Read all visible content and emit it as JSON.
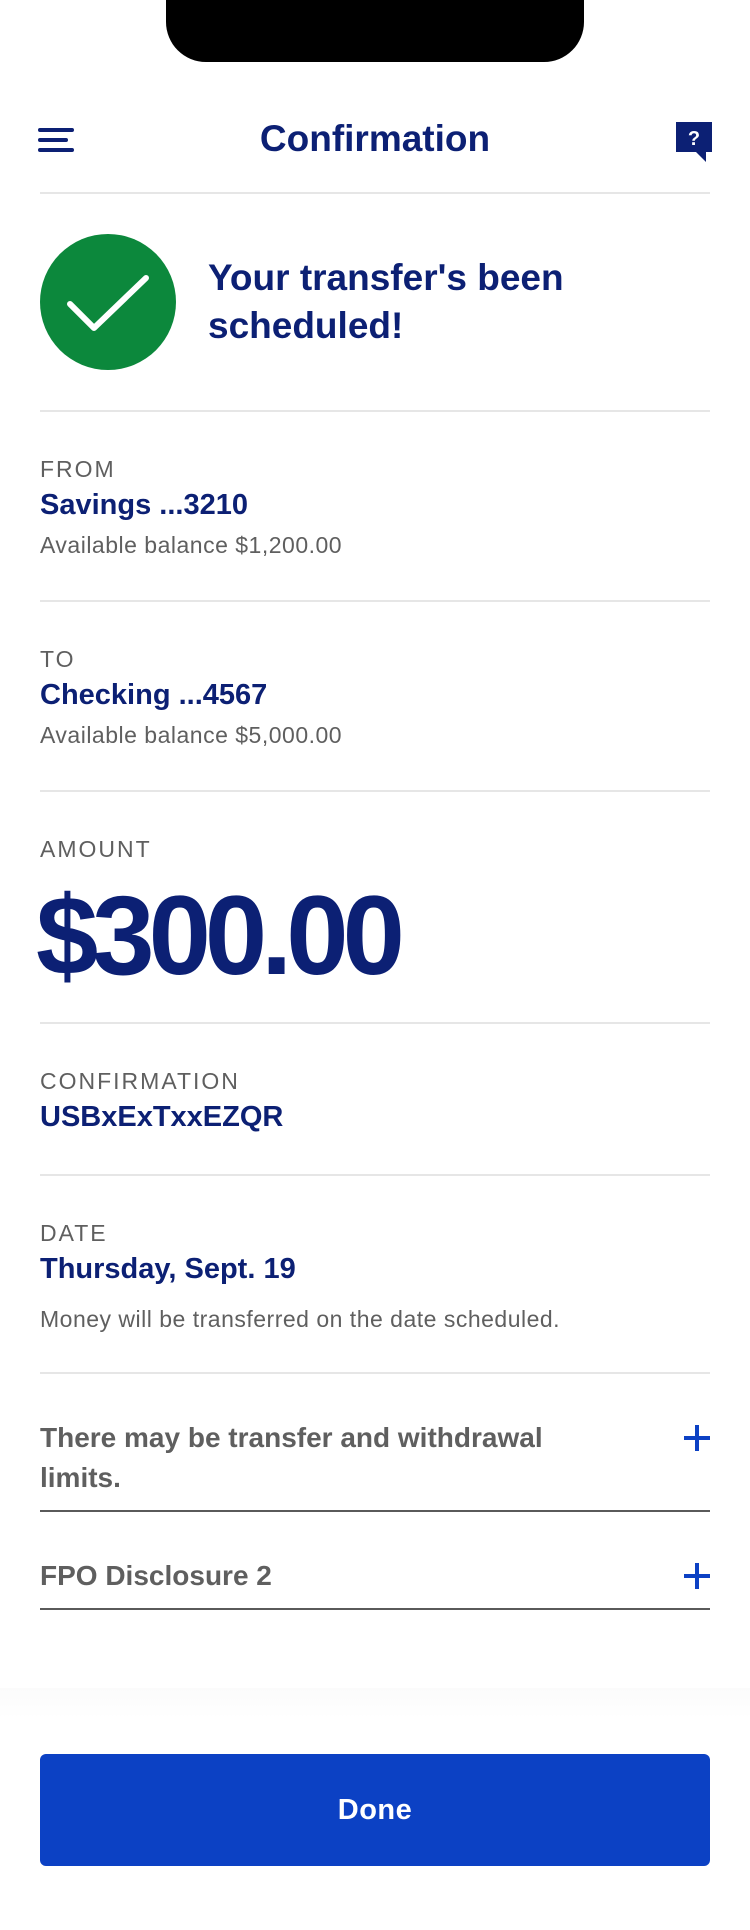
{
  "header": {
    "title": "Confirmation",
    "menu_icon": "hamburger-menu-icon",
    "help_icon": "help-chat-icon",
    "help_glyph": "?"
  },
  "success": {
    "message": "Your transfer's been scheduled!",
    "icon": "checkmark-icon",
    "color": "#0c883c"
  },
  "from": {
    "label": "FROM",
    "account": "Savings ...3210",
    "balance": "Available balance $1,200.00"
  },
  "to": {
    "label": "TO",
    "account": "Checking ...4567",
    "balance": "Available balance $5,000.00"
  },
  "amount": {
    "label": "AMOUNT",
    "value": "$300.00"
  },
  "confirmation": {
    "label": "CONFIRMATION",
    "code": "USBxExTxxEZQR"
  },
  "date": {
    "label": "DATE",
    "value": "Thursday, Sept. 19",
    "note": "Money will be transferred on the date scheduled."
  },
  "disclosures": [
    {
      "text": "There may be transfer and withdrawal limits."
    },
    {
      "text": "FPO Disclosure 2"
    }
  ],
  "footer": {
    "done_label": "Done"
  },
  "colors": {
    "primary_text": "#0c2074",
    "accent": "#0c41c4",
    "secondary_text": "#5f5f5f",
    "success": "#0c883c"
  }
}
